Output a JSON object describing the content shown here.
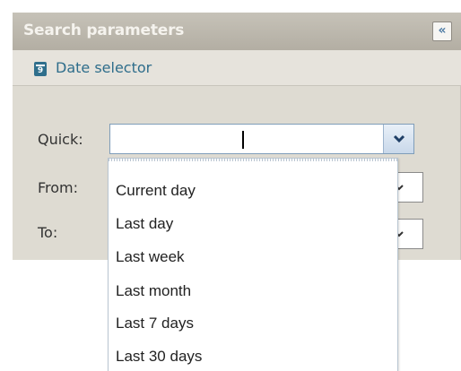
{
  "panel": {
    "title": "Search parameters",
    "collapse_icon": "double-chevron-left-icon",
    "collapse_glyph": "«"
  },
  "section": {
    "icon": "calendar-icon",
    "icon_digit": "9",
    "title": "Date selector"
  },
  "fields": {
    "quick_label": "Quick:",
    "quick_value": "",
    "from_label": "From:",
    "to_label": "To:"
  },
  "dropdown": {
    "options": [
      "Current day",
      "Last day",
      "Last week",
      "Last month",
      "Last 7 days",
      "Last 30 days"
    ]
  },
  "colors": {
    "panel_bg": "#dedbd2",
    "header_bg": "#b3aea3",
    "accent": "#2e6d8b"
  }
}
